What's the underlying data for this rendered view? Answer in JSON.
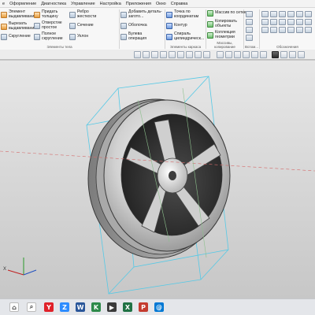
{
  "menu": {
    "items": [
      "е",
      "Оформление",
      "Диагностика",
      "Управление",
      "Настройка",
      "Приложения",
      "Окно",
      "Справка"
    ]
  },
  "ribbon": {
    "col1": [
      "Элемент выдавливания",
      "Вырезать выдавливанием",
      "Скругление"
    ],
    "col2": [
      "Придать толщину",
      "Отверстие простое",
      "Полное скругление"
    ],
    "col3": [
      "Ребро жесткости",
      "Сечение",
      "Уклон"
    ],
    "col4": [
      "Добавить деталь-загото...",
      "Оболочка",
      "Булева операция"
    ],
    "col5": [
      "Точка по координатам",
      "Контур",
      "Спираль цилиндрическ..."
    ],
    "col6": [
      "Массив по сетке",
      "Копировать объекты",
      "Коллекция геометрии"
    ],
    "group_labels": {
      "solids": "Элементы тела",
      "frame": "Элементы каркаса",
      "arrays": "Массивы, копирование",
      "aux": "Вспом...",
      "marking": "Обозначения"
    }
  },
  "viewport": {
    "axis_label": "X"
  },
  "taskbar": {
    "apps": [
      {
        "name": "yandex-app",
        "glyph": "Y",
        "color": "#e0222a"
      },
      {
        "name": "zoom-app",
        "glyph": "Z",
        "color": "#2d8cff"
      },
      {
        "name": "word-app",
        "glyph": "W",
        "color": "#2b579a"
      },
      {
        "name": "kompas-app",
        "glyph": "K",
        "color": "#2d8a4a"
      },
      {
        "name": "media-app",
        "glyph": "▶",
        "color": "#3a3a3a"
      },
      {
        "name": "excel-app",
        "glyph": "X",
        "color": "#1f7244"
      },
      {
        "name": "pdf-app",
        "glyph": "P",
        "color": "#c43b2f"
      },
      {
        "name": "mail-app",
        "glyph": "@",
        "color": "#0078d4"
      }
    ]
  }
}
